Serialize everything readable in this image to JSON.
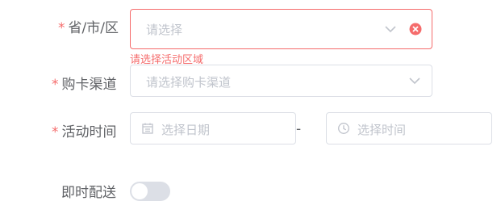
{
  "region": {
    "label": "省/市/区",
    "placeholder": "请选择",
    "error": "请选择活动区域"
  },
  "channel": {
    "label": "购卡渠道",
    "placeholder": "请选择购卡渠道"
  },
  "activity_time": {
    "label": "活动时间",
    "date_placeholder": "选择日期",
    "separator": "-",
    "time_placeholder": "选择时间"
  },
  "instant_delivery": {
    "label": "即时配送"
  },
  "colors": {
    "error": "#f56c6c",
    "border": "#dcdfe6",
    "placeholder": "#c0c4cc"
  }
}
